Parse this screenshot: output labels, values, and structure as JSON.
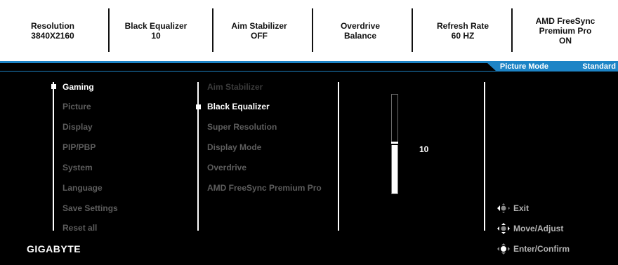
{
  "status_bar": [
    {
      "label": "Resolution",
      "value": "3840X2160"
    },
    {
      "label": "Black Equalizer",
      "value": "10"
    },
    {
      "label": "Aim Stabilizer",
      "value": "OFF"
    },
    {
      "label": "Overdrive",
      "value": "Balance"
    },
    {
      "label": "Refresh Rate",
      "value": "60 HZ"
    },
    {
      "label": "AMD FreeSync\nPremium Pro",
      "value": "ON"
    }
  ],
  "picture_mode": {
    "label": "Picture Mode",
    "value": "Standard"
  },
  "main_menu": {
    "items": [
      "Gaming",
      "Picture",
      "Display",
      "PIP/PBP",
      "System",
      "Language",
      "Save Settings",
      "Reset all"
    ],
    "selected": "Gaming"
  },
  "sub_menu": {
    "items": [
      "Aim Stabilizer",
      "Black Equalizer",
      "Super Resolution",
      "Display Mode",
      "Overdrive",
      "AMD FreeSync Premium Pro"
    ],
    "selected": "Black Equalizer"
  },
  "slider": {
    "setting": "Black Equalizer",
    "value": "10",
    "min": 0,
    "max": 20,
    "fraction": 0.5
  },
  "hints": [
    {
      "icon": "joystick-left-icon",
      "label": "Exit"
    },
    {
      "icon": "joystick-all-directions-icon",
      "label": "Move/Adjust"
    },
    {
      "icon": "joystick-press-icon",
      "label": "Enter/Confirm"
    }
  ],
  "brand": {
    "logo_text": "GIGABYTE",
    "accent_color": "#1d84c6"
  }
}
